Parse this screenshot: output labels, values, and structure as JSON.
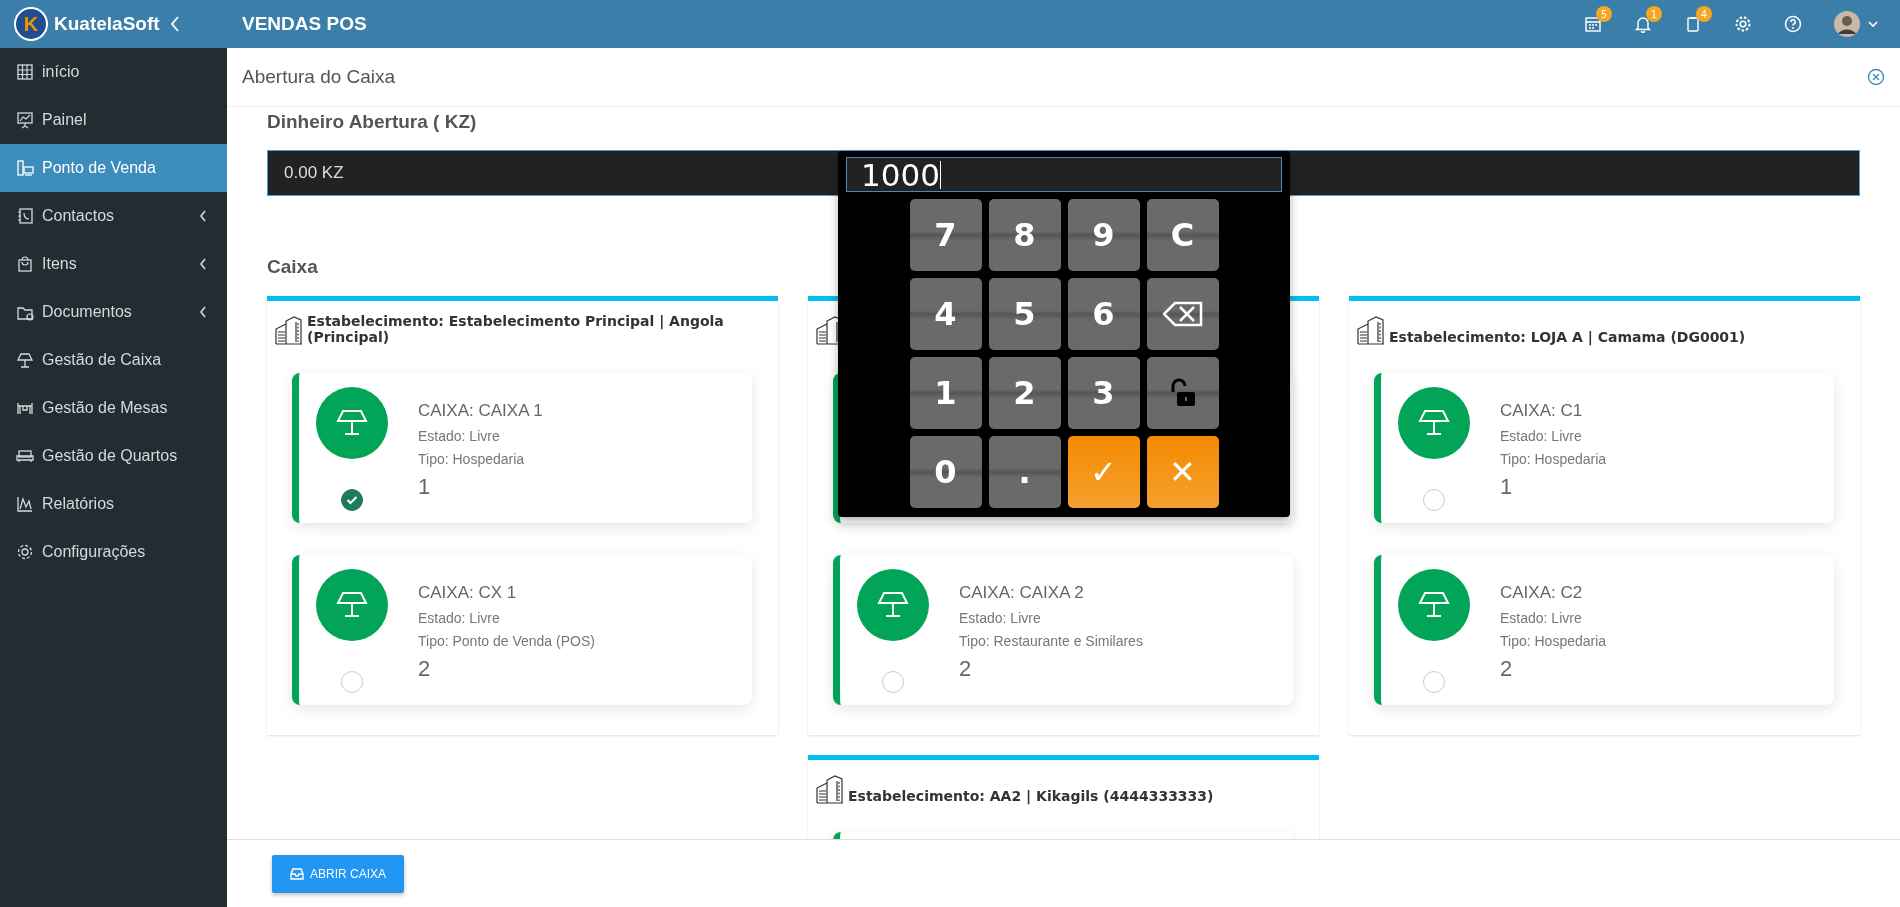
{
  "header": {
    "logo_mark": "K",
    "brand": "KuatelaSoft",
    "app_title": "VENDAS POS",
    "notifications": [
      {
        "count": "5"
      },
      {
        "count": "1"
      },
      {
        "count": "4"
      }
    ]
  },
  "sidebar": {
    "items": [
      {
        "label": "início",
        "selected": false,
        "submenu": false
      },
      {
        "label": "Painel",
        "selected": false,
        "submenu": false
      },
      {
        "label": "Ponto de Venda",
        "selected": true,
        "submenu": false
      },
      {
        "label": "Contactos",
        "selected": false,
        "submenu": true
      },
      {
        "label": "Itens",
        "selected": false,
        "submenu": true
      },
      {
        "label": "Documentos",
        "selected": false,
        "submenu": true
      },
      {
        "label": "Gestão de Caixa",
        "selected": false,
        "submenu": false
      },
      {
        "label": "Gestão de Mesas",
        "selected": false,
        "submenu": false
      },
      {
        "label": "Gestão de Quartos",
        "selected": false,
        "submenu": false
      },
      {
        "label": "Relatórios",
        "selected": false,
        "submenu": false
      },
      {
        "label": "Configurações",
        "selected": false,
        "submenu": false
      }
    ]
  },
  "dialog": {
    "title": "Abertura do Caixa"
  },
  "opening_cash": {
    "label": "Dinheiro Abertura ( KZ)",
    "value": "0.00 KZ"
  },
  "section_title": "Caixa",
  "columns": [
    {
      "establishments": [
        {
          "title": "Estabelecimento: Estabelecimento Principal | Angola (Principal)",
          "cards": [
            {
              "kind": "register",
              "name": "CAIXA: CAIXA 1",
              "status": "Estado: Livre",
              "type": "Tipo: Hospedaria",
              "number": "1",
              "selected": true
            },
            {
              "kind": "register",
              "name": "CAIXA: CX 1",
              "status": "Estado: Livre",
              "type": "Tipo: Ponto de Venda (POS)",
              "number": "2",
              "selected": false
            }
          ]
        }
      ]
    },
    {
      "establishments": [
        {
          "cards": [
            {
              "kind": "covered"
            },
            {
              "kind": "register",
              "name": "CAIXA: CAIXA 2",
              "status": "Estado: Livre",
              "type": "Tipo: Restaurante e Similares",
              "number": "2",
              "selected": false
            }
          ]
        },
        {
          "title": "Estabelecimento: AA2 | Kikagils (4444333333)",
          "cards": [
            {
              "kind": "covered"
            }
          ]
        }
      ]
    },
    {
      "establishments": [
        {
          "title": "Estabelecimento: LOJA A | Camama (DG0001)",
          "cards": [
            {
              "kind": "register",
              "name": "CAIXA: C1",
              "status": "Estado: Livre",
              "type": "Tipo: Hospedaria",
              "number": "1",
              "selected": false
            },
            {
              "kind": "register",
              "name": "CAIXA: C2",
              "status": "Estado: Livre",
              "type": "Tipo: Hospedaria",
              "number": "2",
              "selected": false
            }
          ]
        }
      ]
    }
  ],
  "keypad": {
    "display": "1000",
    "keys": [
      {
        "kind": "digit",
        "label": "7"
      },
      {
        "kind": "digit",
        "label": "8"
      },
      {
        "kind": "digit",
        "label": "9"
      },
      {
        "kind": "clear",
        "label": "C"
      },
      {
        "kind": "digit",
        "label": "4"
      },
      {
        "kind": "digit",
        "label": "5"
      },
      {
        "kind": "digit",
        "label": "6"
      },
      {
        "kind": "backspace"
      },
      {
        "kind": "digit",
        "label": "1"
      },
      {
        "kind": "digit",
        "label": "2"
      },
      {
        "kind": "digit",
        "label": "3"
      },
      {
        "kind": "lock"
      },
      {
        "kind": "digit",
        "label": "0"
      },
      {
        "kind": "digit",
        "label": "."
      },
      {
        "kind": "confirm",
        "label": "✓"
      },
      {
        "kind": "cancel",
        "label": "✕"
      }
    ]
  },
  "footer": {
    "button": "ABRIR CAIXA"
  }
}
